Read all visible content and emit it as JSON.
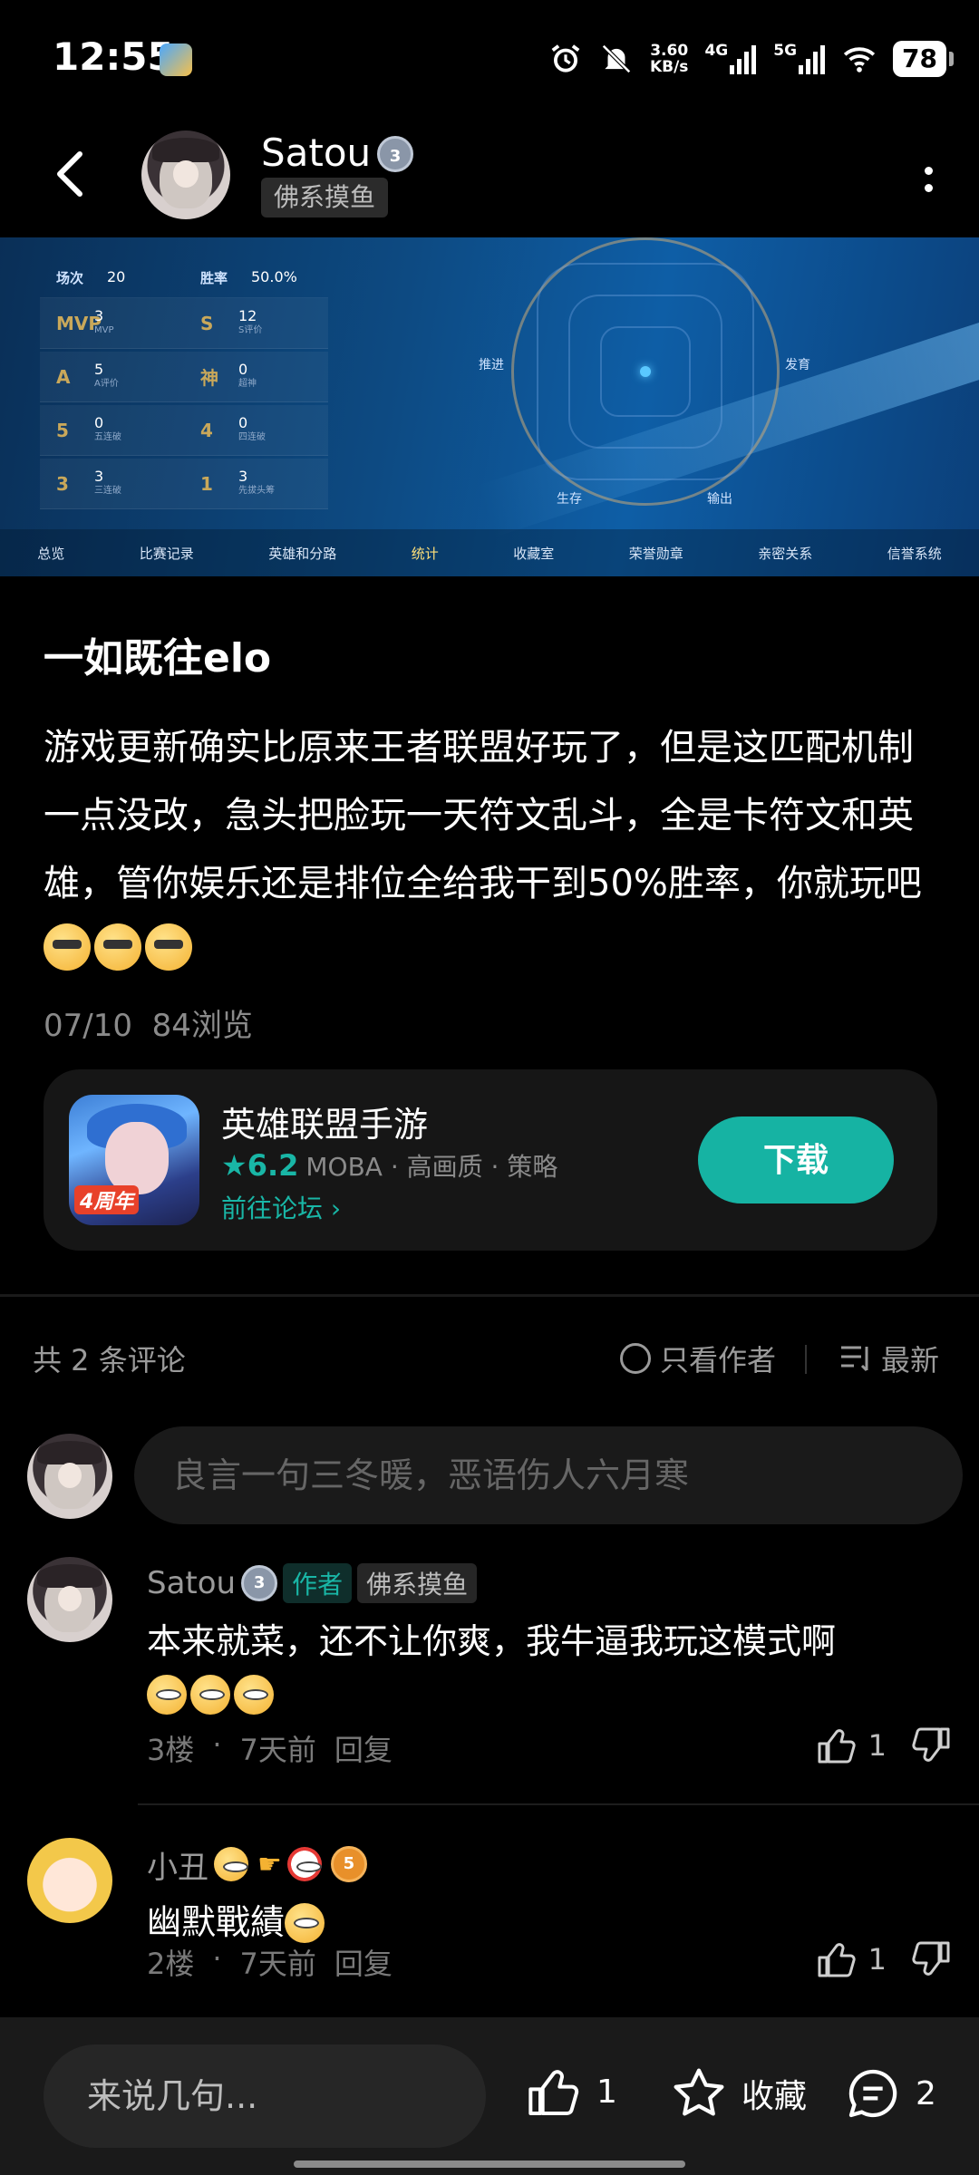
{
  "status_bar": {
    "time": "12:55",
    "net_speed_value": "3.60",
    "net_speed_unit": "KB/s",
    "net1": "4G",
    "net2": "5G",
    "battery": "78"
  },
  "header": {
    "username": "Satou",
    "level": "3",
    "tag": "佛系摸鱼"
  },
  "banner": {
    "stats": [
      {
        "k1": "场次",
        "v1": "20",
        "k2": "胜率",
        "v2": "50.0%"
      },
      {
        "k1": "MVP",
        "v1": "3",
        "s1": "MVP",
        "k2": "S",
        "v2": "12",
        "s2": "S评价"
      },
      {
        "k1": "A",
        "v1": "5",
        "s1": "A评价",
        "k2": "神",
        "v2": "0",
        "s2": "超神"
      },
      {
        "k1": "5",
        "v1": "0",
        "s1": "五连破",
        "k2": "4",
        "v2": "0",
        "s2": "四连破"
      },
      {
        "k1": "3",
        "v1": "3",
        "s1": "三连破",
        "k2": "1",
        "v2": "3",
        "s2": "先拔头筹"
      }
    ],
    "radar_labels": {
      "left": "推进",
      "right": "发育",
      "bottom_left": "生存",
      "bottom_right": "输出"
    },
    "tabs": [
      "总览",
      "比赛记录",
      "英雄和分路",
      "统计",
      "收藏室",
      "荣誉勋章",
      "亲密关系",
      "信誉系统"
    ],
    "active_tab": "统计"
  },
  "post": {
    "title": "一如既往elo",
    "body": "游戏更新确实比原来王者联盟好玩了，但是这匹配机制一点没改，急头把脸玩一天符文乱斗，全是卡符文和英雄，管你娱乐还是排位全给我干到50%胜率，你就玩吧",
    "date": "07/10",
    "views": "84浏览"
  },
  "game_card": {
    "name": "英雄联盟手游",
    "rating": "6.2",
    "tags": "MOBA · 高画质 · 策略",
    "forum_link": "前往论坛",
    "icon_badge": "4周年",
    "download_label": "下载",
    "accent": "#16b3a3"
  },
  "comments_header": {
    "count": "共 2 条评论",
    "only_author": "只看作者",
    "sort": "最新"
  },
  "comment_input": {
    "placeholder": "良言一句三冬暖，恶语伤人六月寒"
  },
  "comments": [
    {
      "name": "Satou",
      "level": "3",
      "author_tag": "作者",
      "tag": "佛系摸鱼",
      "text": "本来就菜，还不让你爽，我牛逼我玩这模式啊",
      "floor": "3楼",
      "time": "7天前",
      "reply": "回复",
      "likes": "1"
    },
    {
      "name": "小丑",
      "level": "5",
      "text": "幽默戰績",
      "floor": "2楼",
      "time": "7天前",
      "reply": "回复",
      "likes": "1"
    }
  ],
  "bottom_bar": {
    "input_placeholder": "来说几句...",
    "likes": "1",
    "favorite": "收藏",
    "comments": "2"
  }
}
